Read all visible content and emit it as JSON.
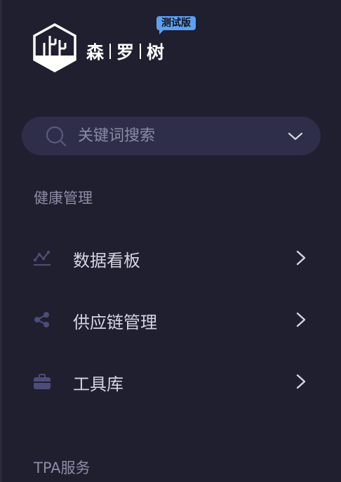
{
  "brand": {
    "char1": "森",
    "char2": "罗",
    "char3": "树",
    "badge": "测试版"
  },
  "search": {
    "placeholder": "关键词搜索"
  },
  "sections": [
    {
      "title": "健康管理",
      "items": [
        {
          "label": "数据看板",
          "icon": "chart-line-icon"
        },
        {
          "label": "供应链管理",
          "icon": "share-nodes-icon"
        },
        {
          "label": "工具库",
          "icon": "briefcase-icon"
        }
      ]
    },
    {
      "title": "TPA服务",
      "items": []
    }
  ],
  "colors": {
    "background": "#1f1f2f",
    "search_bg": "#2e2e4a",
    "badge": "#5ca0f2",
    "icon": "#4d4d7a",
    "label": "#d6d6e2",
    "section_title": "#8c8ca5"
  }
}
